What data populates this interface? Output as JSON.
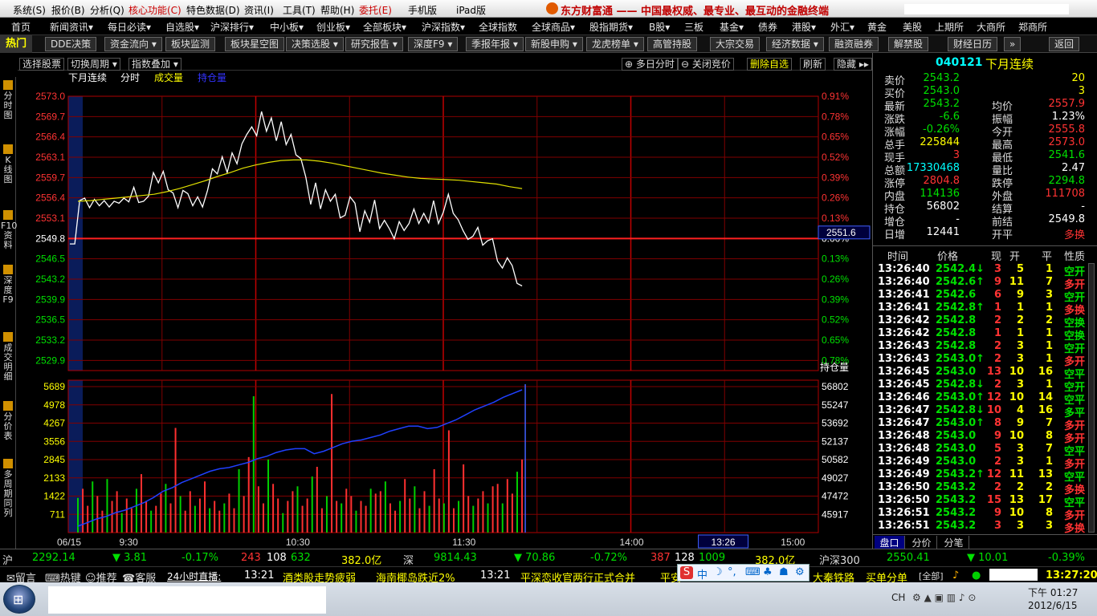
{
  "menu": [
    "系统(S)",
    "报价(B)",
    "分析(Q)",
    "核心功能(C)",
    "特色数据(D)",
    "资讯(I)",
    "工具(T)",
    "帮助(H)",
    "委托(E)",
    "手机版",
    "iPad版"
  ],
  "brand": "东方财富通 —— 中国最权威、最专业、最互动的金融终端",
  "nav": [
    "首页",
    "新闻资讯▾",
    "每日必读▾",
    "自选股▾",
    "沪深排行▾",
    "中小板▾",
    "创业板▾",
    "全部板块▾",
    "沪深指数▾",
    "全球指数",
    "全球商品▾",
    "股指期货▾",
    "B股▾",
    "三板",
    "基金▾",
    "债券",
    "港股▾",
    "外汇▾",
    "黄金",
    "美股",
    "上期所",
    "大商所",
    "郑商所"
  ],
  "hot": "热门",
  "buttons": [
    "DDE决策",
    "资金流向 ▾",
    "板块监测",
    "板块星空图",
    "决策选股 ▾",
    "研究报告 ▾",
    "深度F9 ▾",
    "季报年报 ▾",
    "新股申购 ▾",
    "龙虎榜单 ▾",
    "高管持股",
    "大宗交易",
    "经济数据 ▾",
    "融资融券",
    "解禁股",
    "财经日历",
    "»",
    "返回"
  ],
  "toolbar": {
    "select": "选择股票",
    "period": "切换周期 ▾",
    "overlay": "指数叠加 ▾",
    "multiday": "多日分时",
    "closebid": "关闭竞价",
    "delfav": "删除自选",
    "refresh": "刷新",
    "hide": "隐藏 ▸▸"
  },
  "legend": {
    "name": "下月连续",
    "t": "分时",
    "vol": "成交量",
    "oi": "持仓量"
  },
  "sidebar": [
    "分时图",
    "K线图",
    "F10资料",
    "深度F9",
    "成交明细",
    "分价表",
    "多周期同列"
  ],
  "chart_data": {
    "type": "line",
    "title": "下月连续",
    "price_axis": [
      "2573.0",
      "2569.7",
      "2566.4",
      "2563.1",
      "2559.7",
      "2556.4",
      "2553.1",
      "2549.8",
      "2546.5",
      "2543.2",
      "2539.9",
      "2536.5",
      "2533.2",
      "2529.9"
    ],
    "pct_axis": [
      "0.91%",
      "0.78%",
      "0.65%",
      "0.52%",
      "0.39%",
      "0.26%",
      "0.13%",
      "0.00%",
      "0.13%",
      "0.26%",
      "0.39%",
      "0.52%",
      "0.65%",
      "0.78%"
    ],
    "vol_axis": [
      "5689",
      "4978",
      "4267",
      "3556",
      "2845",
      "2133",
      "1422",
      "711"
    ],
    "oi_axis": [
      "56802",
      "55247",
      "53692",
      "52137",
      "50582",
      "49027",
      "47472",
      "45917"
    ],
    "oi_label": "持仓量",
    "time_axis": [
      "06/15",
      "9:30",
      "10:30",
      "11:30",
      "14:00",
      "15:00"
    ],
    "cursor_price": "2551.6",
    "cursor_time": "13:26",
    "prev_settle": 2549.8,
    "ylim": [
      2529.9,
      2573.0
    ],
    "price": [
      2549.8,
      2549.8,
      2556.6,
      2557.0,
      2555.5,
      2556.8,
      2555.8,
      2556.6,
      2555.6,
      2556.5,
      2556.2,
      2557.0,
      2556.4,
      2558.7,
      2556.3,
      2556.5,
      2557.3,
      2561.0,
      2559.4,
      2561.2,
      2558.3,
      2557.8,
      2555.5,
      2558.2,
      2557.7,
      2555.8,
      2557.2,
      2555.6,
      2558.2,
      2561.6,
      2560.8,
      2563.5,
      2561.0,
      2564.1,
      2562.4,
      2565.5,
      2567.0,
      2568.2,
      2566.8,
      2570.6,
      2567.5,
      2569.6,
      2566.0,
      2569.0,
      2565.4,
      2567.0,
      2563.8,
      2563.2,
      2560.3,
      2556.0,
      2559.4,
      2555.3,
      2558.3,
      2556.5,
      2557.6,
      2553.9,
      2554.3,
      2557.2,
      2556.2,
      2551.7,
      2555.0,
      2553.2,
      2556.7,
      2552.2,
      2553.5,
      2552.2,
      2550.6,
      2553.3,
      2551.9,
      2553.0,
      2555.3,
      2553.0,
      2554.6,
      2553.1,
      2556.6,
      2553.0,
      2554.8,
      2557.6,
      2554.6,
      2553.6,
      2551.9,
      2550.5,
      2551.0,
      2552.4,
      2549.6,
      2550.3,
      2550.6,
      2547.1,
      2546.0,
      2547.6,
      2546.4,
      2543.6,
      2543.2
    ],
    "avg": [
      2556.5,
      2556.6,
      2556.8,
      2557.0,
      2557.2,
      2557.4,
      2557.6,
      2558.0,
      2558.5,
      2559.1,
      2559.7,
      2560.4,
      2561.0,
      2561.7,
      2562.2,
      2562.6,
      2562.9,
      2563.0,
      2563.0,
      2562.8,
      2562.5,
      2562.1,
      2561.7,
      2561.3,
      2560.9,
      2560.6,
      2560.3,
      2560.1,
      2560.0,
      2559.9,
      2559.8,
      2559.6,
      2559.4,
      2559.2,
      2558.8,
      2558.5
    ],
    "volume": [
      1422,
      1800,
      1100,
      2100,
      1500,
      900,
      2200,
      1300,
      1700,
      800,
      1400,
      1000,
      1800,
      2400,
      1300,
      900,
      1100,
      1600,
      2000,
      1200,
      4300,
      1500,
      900,
      1700,
      1100,
      1400,
      2100,
      1000,
      1300,
      900,
      1200,
      1600,
      1000,
      2600,
      1500,
      3100,
      5600,
      1900,
      1200,
      3000,
      2000,
      1400,
      800,
      1300,
      1700,
      1900,
      1100,
      1400,
      2300,
      2700,
      1000,
      1500,
      5689,
      1300,
      1200,
      1800,
      1500,
      900,
      1300,
      1100,
      1800,
      1600,
      1700,
      2100,
      1200,
      900,
      1300,
      2200,
      1400,
      1900,
      1000,
      1700,
      1100,
      2600,
      1400,
      1200,
      4200,
      1000,
      1300,
      2800,
      1500,
      1100,
      1400,
      1700,
      1200,
      1900,
      2000,
      1200,
      2200,
      1600,
      2500,
      3000
    ],
    "oi": [
      45917,
      46200,
      46500,
      46700,
      47000,
      47200,
      47500,
      47800,
      48200,
      48700,
      49000,
      49400,
      49700,
      50000,
      50300,
      50500,
      50600,
      50800,
      51000,
      51300,
      51500,
      51800,
      52000,
      52100,
      52100,
      51700,
      51900,
      52200,
      52500,
      52700,
      52800,
      53000,
      53200,
      53500,
      53700,
      53900,
      53900,
      53700,
      53800,
      54100,
      54400,
      54800,
      55200,
      55500,
      55800,
      56200,
      56500,
      56802
    ]
  },
  "quote": {
    "code": "040121",
    "name": "下月连续",
    "rows": [
      {
        "l1": "卖价",
        "v1": "2543.2",
        "c1": "dn",
        "l2": "",
        "v2": "20",
        "c2": "yl"
      },
      {
        "l1": "买价",
        "v1": "2543.0",
        "c1": "dn",
        "l2": "",
        "v2": "3",
        "c2": "yl"
      },
      {
        "l1": "最新",
        "v1": "2543.2",
        "c1": "dn",
        "l2": "均价",
        "v2": "2557.9",
        "c2": "up"
      },
      {
        "l1": "涨跌",
        "v1": "-6.6",
        "c1": "dn",
        "l2": "振幅",
        "v2": "1.23%",
        "c2": "wh"
      },
      {
        "l1": "涨幅",
        "v1": "-0.26%",
        "c1": "dn",
        "l2": "今开",
        "v2": "2555.8",
        "c2": "up"
      },
      {
        "l1": "总手",
        "v1": "225844",
        "c1": "yl",
        "l2": "最高",
        "v2": "2573.0",
        "c2": "up"
      },
      {
        "l1": "现手",
        "v1": "3",
        "c1": "up",
        "l2": "最低",
        "v2": "2541.6",
        "c2": "dn"
      },
      {
        "l1": "总额",
        "v1": "17330468",
        "c1": "cy",
        "l2": "量比",
        "v2": "2.47",
        "c2": "wh"
      },
      {
        "l1": "涨停",
        "v1": "2804.8",
        "c1": "up",
        "l2": "跌停",
        "v2": "2294.8",
        "c2": "dn"
      },
      {
        "l1": "内盘",
        "v1": "114136",
        "c1": "dn",
        "l2": "外盘",
        "v2": "111708",
        "c2": "up"
      },
      {
        "l1": "持仓",
        "v1": "56802",
        "c1": "wh",
        "l2": "结算",
        "v2": "-",
        "c2": "wh"
      },
      {
        "l1": "增仓",
        "v1": "-",
        "c1": "wh",
        "l2": "前结",
        "v2": "2549.8",
        "c2": "wh"
      },
      {
        "l1": "日增",
        "v1": "12441",
        "c1": "wh",
        "l2": "开平",
        "v2": "多换",
        "c2": "up"
      }
    ]
  },
  "trades_header": [
    "时间",
    "价格",
    "现",
    "开",
    "平",
    "性质"
  ],
  "trades": [
    {
      "t": "13:26:40",
      "p": "2542.4↓",
      "pc": "dn",
      "n": "3",
      "o": "5",
      "c": "1",
      "k": "空开",
      "kc": "dn"
    },
    {
      "t": "13:26:40",
      "p": "2542.6↑",
      "pc": "dn",
      "n": "9",
      "o": "11",
      "c": "7",
      "k": "多开",
      "kc": "up"
    },
    {
      "t": "13:26:41",
      "p": "2542.6",
      "pc": "dn",
      "n": "6",
      "o": "9",
      "c": "3",
      "k": "空开",
      "kc": "dn"
    },
    {
      "t": "13:26:41",
      "p": "2542.8↑",
      "pc": "dn",
      "n": "1",
      "o": "1",
      "c": "1",
      "k": "多换",
      "kc": "up"
    },
    {
      "t": "13:26:42",
      "p": "2542.8",
      "pc": "dn",
      "n": "2",
      "o": "2",
      "c": "2",
      "k": "空换",
      "kc": "dn"
    },
    {
      "t": "13:26:42",
      "p": "2542.8",
      "pc": "dn",
      "n": "1",
      "o": "1",
      "c": "1",
      "k": "空换",
      "kc": "dn"
    },
    {
      "t": "13:26:43",
      "p": "2542.8",
      "pc": "dn",
      "n": "2",
      "o": "3",
      "c": "1",
      "k": "空开",
      "kc": "dn"
    },
    {
      "t": "13:26:43",
      "p": "2543.0↑",
      "pc": "dn",
      "n": "2",
      "o": "3",
      "c": "1",
      "k": "多开",
      "kc": "up"
    },
    {
      "t": "13:26:45",
      "p": "2543.0",
      "pc": "dn",
      "n": "13",
      "o": "10",
      "c": "16",
      "k": "空平",
      "kc": "dn"
    },
    {
      "t": "13:26:45",
      "p": "2542.8↓",
      "pc": "dn",
      "n": "2",
      "o": "3",
      "c": "1",
      "k": "空开",
      "kc": "dn"
    },
    {
      "t": "13:26:46",
      "p": "2543.0↑",
      "pc": "dn",
      "n": "12",
      "o": "10",
      "c": "14",
      "k": "空平",
      "kc": "dn"
    },
    {
      "t": "13:26:47",
      "p": "2542.8↓",
      "pc": "dn",
      "n": "10",
      "o": "4",
      "c": "16",
      "k": "多平",
      "kc": "dn"
    },
    {
      "t": "13:26:47",
      "p": "2543.0↑",
      "pc": "dn",
      "n": "8",
      "o": "9",
      "c": "7",
      "k": "多开",
      "kc": "up"
    },
    {
      "t": "13:26:48",
      "p": "2543.0",
      "pc": "dn",
      "n": "9",
      "o": "10",
      "c": "8",
      "k": "多开",
      "kc": "up"
    },
    {
      "t": "13:26:48",
      "p": "2543.0",
      "pc": "dn",
      "n": "5",
      "o": "3",
      "c": "7",
      "k": "空平",
      "kc": "dn"
    },
    {
      "t": "13:26:49",
      "p": "2543.0",
      "pc": "dn",
      "n": "2",
      "o": "3",
      "c": "1",
      "k": "多开",
      "kc": "up"
    },
    {
      "t": "13:26:49",
      "p": "2543.2↑",
      "pc": "dn",
      "n": "12",
      "o": "11",
      "c": "13",
      "k": "空平",
      "kc": "dn"
    },
    {
      "t": "13:26:50",
      "p": "2543.2",
      "pc": "dn",
      "n": "2",
      "o": "2",
      "c": "2",
      "k": "多换",
      "kc": "up"
    },
    {
      "t": "13:26:50",
      "p": "2543.2",
      "pc": "dn",
      "n": "15",
      "o": "13",
      "c": "17",
      "k": "空平",
      "kc": "dn"
    },
    {
      "t": "13:26:51",
      "p": "2543.2",
      "pc": "dn",
      "n": "9",
      "o": "10",
      "c": "8",
      "k": "多开",
      "kc": "up"
    },
    {
      "t": "13:26:51",
      "p": "2543.2",
      "pc": "dn",
      "n": "3",
      "o": "3",
      "c": "3",
      "k": "多换",
      "kc": "up"
    }
  ],
  "tabs": [
    "盘口",
    "分价",
    "分笔"
  ],
  "indices": {
    "sh": "沪",
    "sh_val": "2292.14",
    "sh_chg": "▼ 3.81",
    "sh_pct": "-0.17%",
    "sh_up": "243",
    "sh_fl": "108",
    "sh_dn": "632",
    "sh_amt": "382.0亿",
    "sz": "深",
    "sz_val": "9814.43",
    "sz_chg": "▼ 70.86",
    "sz_pct": "-0.72%",
    "sz_up": "387",
    "sz_fl": "128",
    "sz_dn": "1009",
    "sz_amt": "382.0亿",
    "hs": "沪深300",
    "hs_val": "2550.41",
    "hs_chg": "▼ 10.01",
    "hs_pct": "-0.39%"
  },
  "news": {
    "msg": "留言",
    "hotkey": "热键",
    "rec": "推荐",
    "svc": "客服",
    "live": "24小时直播:",
    "t1": "13:21",
    "n1": "酒类股走势疲弱",
    "n2": "海南椰岛跌近2%",
    "t2": "13:21",
    "n3": "平深恋收官两行正式合并",
    "n4": "平安",
    "n5": "大秦铁路",
    "n6": "买单分单",
    "all": "[全部]",
    "clock": "13:27:20"
  },
  "ime": "中",
  "taskbar": {
    "lang": "CH",
    "time": "下午 01:27",
    "date": "2012/6/15"
  }
}
